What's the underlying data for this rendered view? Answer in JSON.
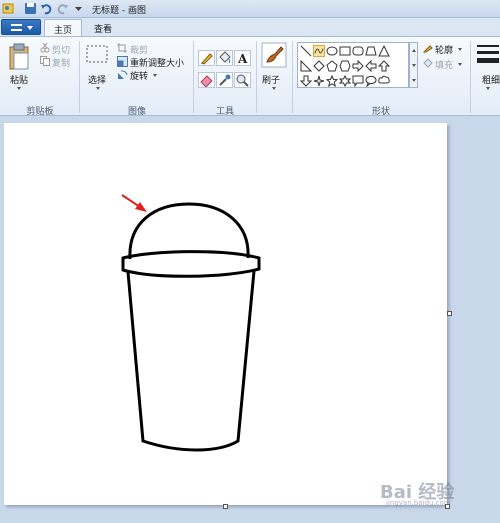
{
  "window": {
    "title": "无标题 - 画图"
  },
  "tabs": [
    {
      "label": "主页",
      "active": true
    },
    {
      "label": "查看",
      "active": false
    }
  ],
  "clipboard": {
    "paste_label": "粘贴",
    "cut_label": "剪切",
    "copy_label": "复制",
    "group_label": "剪贴板"
  },
  "image": {
    "select_label": "选择",
    "crop_label": "裁剪",
    "resize_label": "重新调整大小",
    "rotate_label": "旋转",
    "group_label": "图像"
  },
  "tools": {
    "group_label": "工具"
  },
  "brushes": {
    "label": "刷子"
  },
  "shapes": {
    "outline_label": "轮廓",
    "fill_label": "填充",
    "group_label": "形状"
  },
  "size": {
    "label": "粗细"
  },
  "watermark": {
    "text": "Bai 经验",
    "subtext": "jingyan.baidu.com"
  },
  "colors": {
    "accent": "#1d5aa8",
    "ribbon": "#e3ecf7",
    "workspace": "#c9d7ea",
    "arrow": "#e02020"
  }
}
